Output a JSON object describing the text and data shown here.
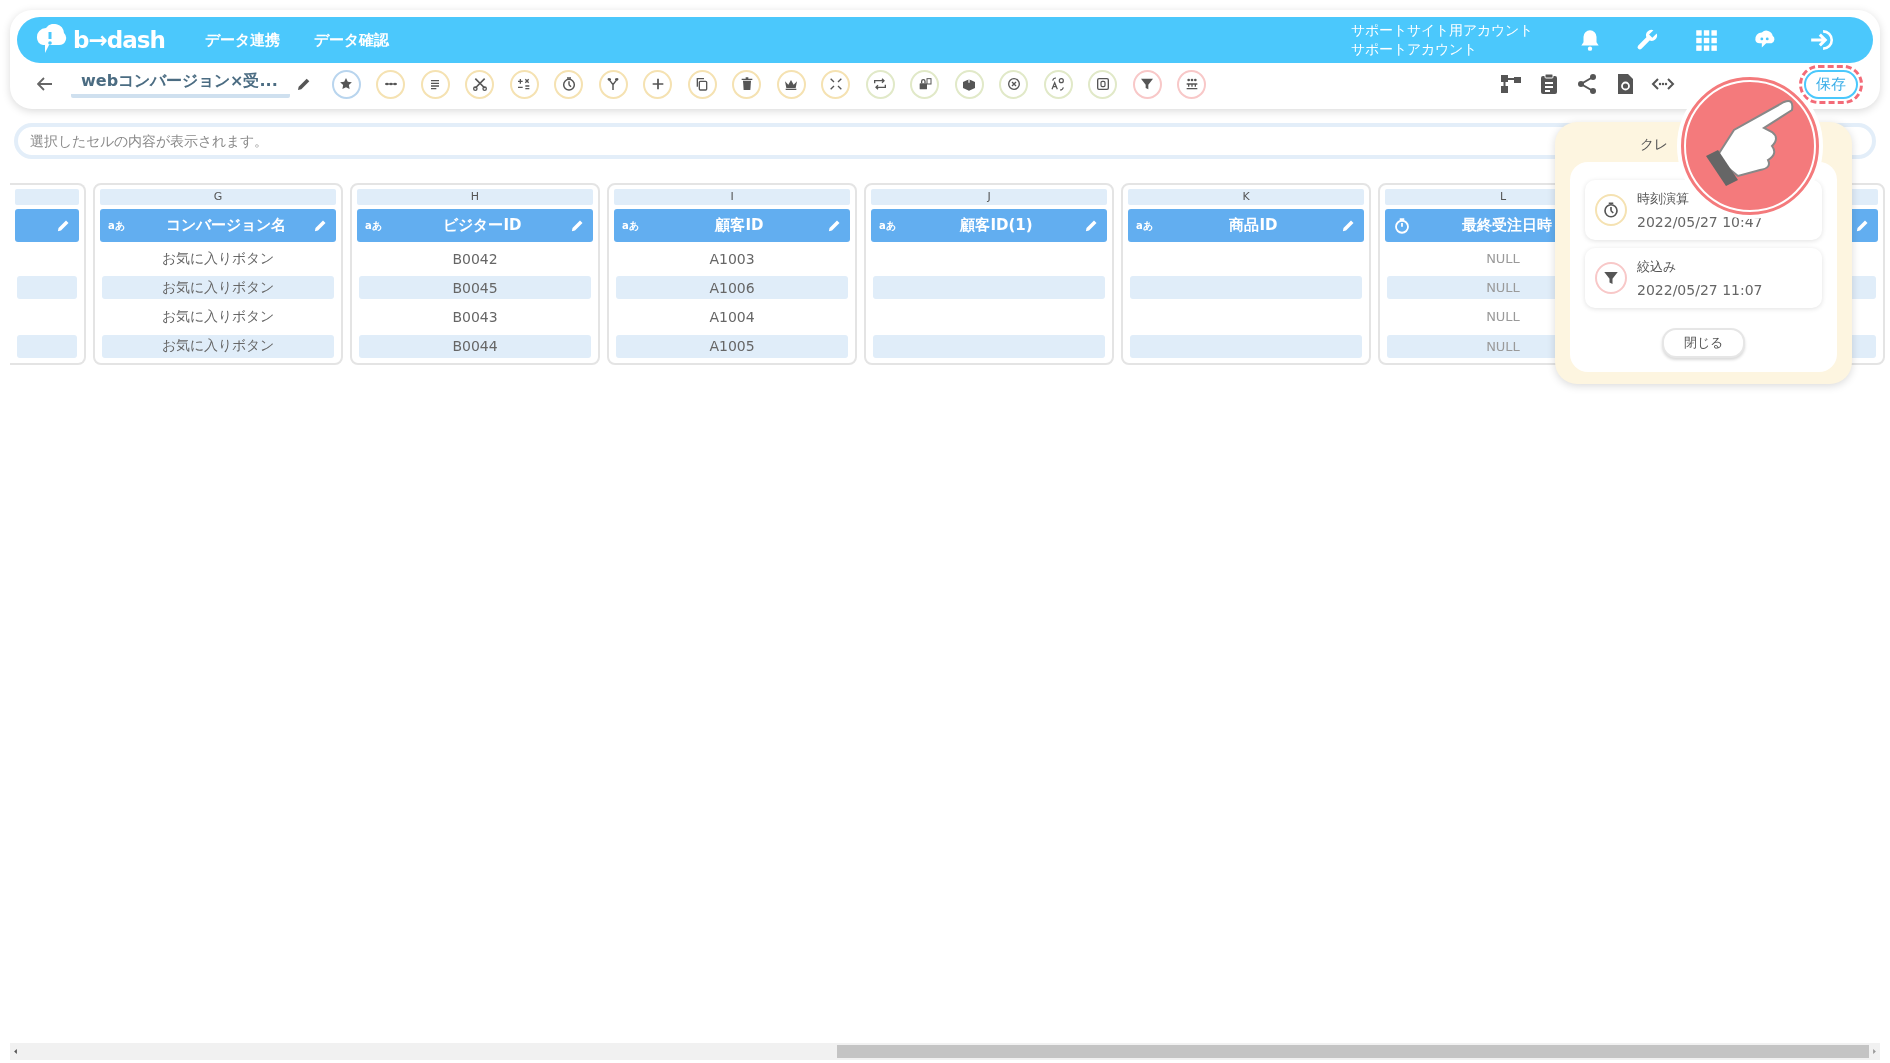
{
  "header": {
    "logo": "b→dash",
    "nav": [
      "データ連携",
      "データ確認"
    ],
    "account": [
      "サポートサイト用アカウント",
      "サポートアカウント"
    ],
    "icons": [
      {
        "kind": "bell"
      },
      {
        "kind": "wrench"
      },
      {
        "kind": "grid"
      },
      {
        "kind": "brain"
      },
      {
        "kind": "logout"
      }
    ]
  },
  "toolbar": {
    "title": "webコンバージョン×受...",
    "tools": [
      {
        "kind": "star",
        "color": "#b9d5ee"
      },
      {
        "kind": "dots",
        "color": "#f5e2b2"
      },
      {
        "kind": "lines",
        "color": "#f5e2b2"
      },
      {
        "kind": "scissors",
        "color": "#f5e2b2"
      },
      {
        "kind": "calc",
        "color": "#f5e2b2"
      },
      {
        "kind": "timer",
        "color": "#f5e2b2"
      },
      {
        "kind": "fork",
        "color": "#f5e2b2"
      },
      {
        "kind": "plus",
        "color": "#f5e2b2"
      },
      {
        "kind": "copy",
        "color": "#f5e2b2"
      },
      {
        "kind": "trash",
        "color": "#f5e2b2"
      },
      {
        "kind": "crown",
        "color": "#f5e2b2"
      },
      {
        "kind": "shrink",
        "color": "#f5e2b2"
      },
      {
        "kind": "swap",
        "color": "#e1e9c8"
      },
      {
        "kind": "lock",
        "color": "#e1e9c8"
      },
      {
        "kind": "boxup",
        "color": "#e1e9c8"
      },
      {
        "kind": "cancel",
        "color": "#e1e9c8"
      },
      {
        "kind": "translate",
        "color": "#e1e9c8"
      },
      {
        "kind": "zero",
        "color": "#e1e9c8"
      },
      {
        "kind": "filter",
        "color": "#f8c8c8"
      },
      {
        "kind": "group",
        "color": "#f8c8c8"
      }
    ],
    "right_tools": [
      {
        "kind": "flow"
      },
      {
        "kind": "clipboard"
      },
      {
        "kind": "share"
      },
      {
        "kind": "docrefresh"
      },
      {
        "kind": "code"
      }
    ],
    "save_button": {
      "label": "保存",
      "highlighted": true
    }
  },
  "cell_bar": {
    "placeholder": "選択したセルの内容が表示されます。"
  },
  "columns": [
    {
      "partial": true,
      "cells": [
        {
          "text": ""
        },
        {
          "text": ""
        },
        {
          "text": ""
        },
        {
          "text": ""
        }
      ]
    },
    {
      "letter": "G",
      "kind": "text",
      "type_label": "aあ",
      "name": "コンバージョン名",
      "cells": [
        {
          "text": "お気に入りボタン"
        },
        {
          "text": "お気に入りボタン"
        },
        {
          "text": "お気に入りボタン"
        },
        {
          "text": "お気に入りボタン"
        }
      ]
    },
    {
      "letter": "H",
      "kind": "text",
      "type_label": "aあ",
      "name": "ビジターID",
      "cells": [
        {
          "text": "B0042"
        },
        {
          "text": "B0045"
        },
        {
          "text": "B0043"
        },
        {
          "text": "B0044"
        }
      ]
    },
    {
      "letter": "I",
      "kind": "text",
      "type_label": "aあ",
      "name": "顧客ID",
      "cells": [
        {
          "text": "A1003"
        },
        {
          "text": "A1006"
        },
        {
          "text": "A1004"
        },
        {
          "text": "A1005"
        }
      ]
    },
    {
      "letter": "J",
      "kind": "text",
      "type_label": "aあ",
      "name": "顧客ID(1)",
      "cells": [
        {
          "text": ""
        },
        {
          "text": ""
        },
        {
          "text": ""
        },
        {
          "text": ""
        }
      ]
    },
    {
      "letter": "K",
      "kind": "text",
      "type_label": "aあ",
      "name": "商品ID",
      "cells": [
        {
          "text": ""
        },
        {
          "text": ""
        },
        {
          "text": ""
        },
        {
          "text": ""
        }
      ]
    },
    {
      "letter": "L",
      "kind": "datetime",
      "name": "最終受注日時",
      "cells": [
        {
          "text": "NULL",
          "null": true
        },
        {
          "text": "NULL",
          "null": true
        },
        {
          "text": "NULL",
          "null": true
        },
        {
          "text": "NULL",
          "null": true
        }
      ]
    },
    {
      "cells": [
        {
          "text": ""
        },
        {
          "text": ""
        },
        {
          "text": ""
        },
        {
          "text": ""
        }
      ]
    }
  ],
  "history_popup": {
    "title": "クレ",
    "items": [
      {
        "kind": "timer",
        "title": "時刻演算",
        "time": "2022/05/27 10:47",
        "color": "#f5e2b2"
      },
      {
        "kind": "filter",
        "title": "絞込み",
        "time": "2022/05/27 11:07",
        "color": "#f8c8c8"
      }
    ],
    "close_button": "閉じる"
  },
  "tutorial_pointer": {
    "visible": true
  }
}
